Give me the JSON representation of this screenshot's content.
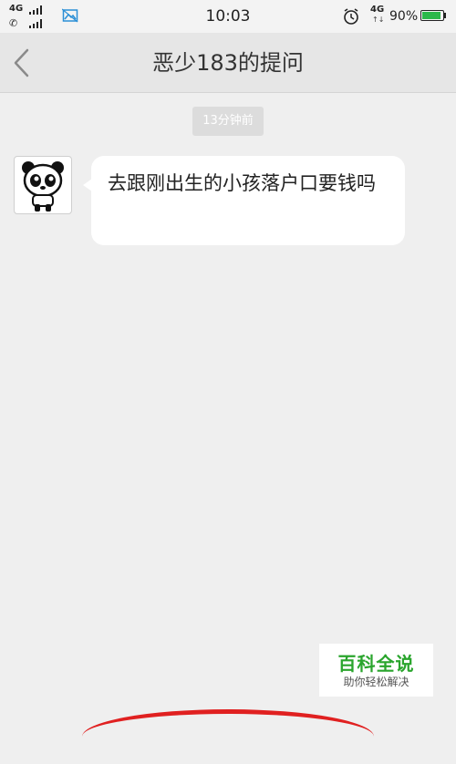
{
  "status_bar": {
    "network_top": "4G",
    "time": "10:03",
    "network_right": "4G",
    "battery": "90%",
    "icons": [
      "signal-icon",
      "phone-icon",
      "gallery-icon",
      "alarm-icon",
      "battery-icon"
    ],
    "battery_color": "#2bb84a"
  },
  "header": {
    "title": "恶少183的提问",
    "back_icon": "chevron-left-icon"
  },
  "chat": {
    "timestamp": "13分钟前",
    "messages": [
      {
        "text": "去跟刚出生的小孩落户口要钱吗"
      }
    ]
  },
  "watermark": {
    "title": "百科全说",
    "subtitle": "助你轻松解决",
    "color": "#2aa52d"
  }
}
